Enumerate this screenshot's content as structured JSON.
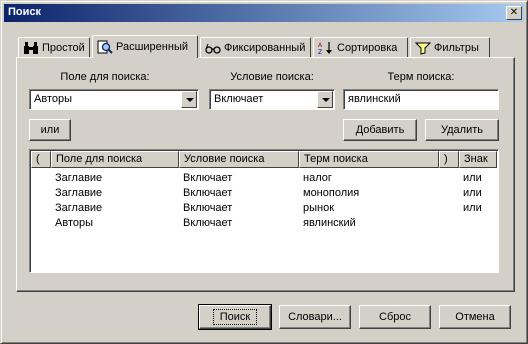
{
  "window": {
    "title": "Поиск",
    "close_glyph": "✕"
  },
  "tabs": [
    {
      "label": "Простой",
      "icon": "binoculars-icon"
    },
    {
      "label": "Расширенный",
      "icon": "search-document-icon"
    },
    {
      "label": "Фиксированный",
      "icon": "glasses-icon"
    },
    {
      "label": "Сортировка",
      "icon": "sort-az-icon"
    },
    {
      "label": "Фильтры",
      "icon": "funnel-icon"
    }
  ],
  "active_tab": "Расширенный",
  "form": {
    "field_label": "Поле для поиска:",
    "field_value": "Авторы",
    "condition_label": "Условие поиска:",
    "condition_value": "Включает",
    "term_label": "Терм поиска:",
    "term_value": "явлинский"
  },
  "buttons": {
    "or": "или",
    "add": "Добавить",
    "delete": "Удалить",
    "search": "Поиск",
    "dictionaries": "Словари...",
    "reset": "Сброс",
    "cancel": "Отмена"
  },
  "table": {
    "headers": [
      "(",
      "Поле для поиска",
      "Условие поиска",
      "Терм поиска",
      ")",
      "Знак"
    ],
    "rows": [
      {
        "open": "",
        "field": "Заглавие",
        "condition": "Включает",
        "term": "налог",
        "close": "",
        "sign": "или"
      },
      {
        "open": "",
        "field": "Заглавие",
        "condition": "Включает",
        "term": "монополия",
        "close": "",
        "sign": "или"
      },
      {
        "open": "",
        "field": "Заглавие",
        "condition": "Включает",
        "term": "рынок",
        "close": "",
        "sign": "или"
      },
      {
        "open": "",
        "field": "Авторы",
        "condition": "Включает",
        "term": "явлинский",
        "close": "",
        "sign": ""
      }
    ]
  },
  "colors": {
    "face": "#d4d0c8",
    "title_start": "#0a246a",
    "title_end": "#a6caf0"
  }
}
